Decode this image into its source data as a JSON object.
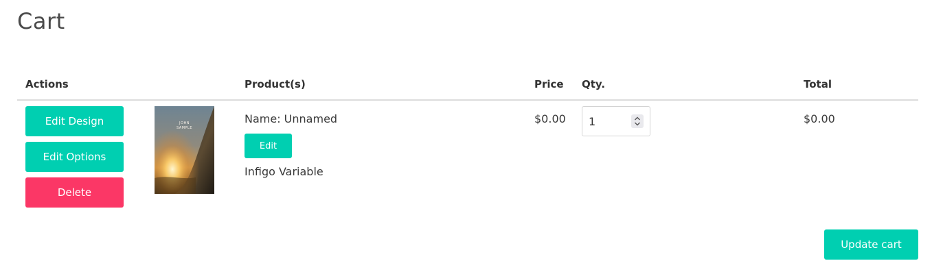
{
  "page": {
    "title": "Cart"
  },
  "table": {
    "headers": {
      "actions": "Actions",
      "products": "Product(s)",
      "price": "Price",
      "qty": "Qty.",
      "total": "Total"
    },
    "row": {
      "actions": {
        "edit_design": "Edit Design",
        "edit_options": "Edit Options",
        "delete": "Delete"
      },
      "thumbnail_text": [
        "JOHN",
        "SAMPLE"
      ],
      "product_name": "Name: Unnamed",
      "edit_label": "Edit",
      "product_type": "Infigo Variable",
      "price": "$0.00",
      "qty": "1",
      "total": "$0.00"
    }
  },
  "footer": {
    "update_cart": "Update cart"
  },
  "colors": {
    "teal": "#00cfb1",
    "red": "#fb3766"
  }
}
